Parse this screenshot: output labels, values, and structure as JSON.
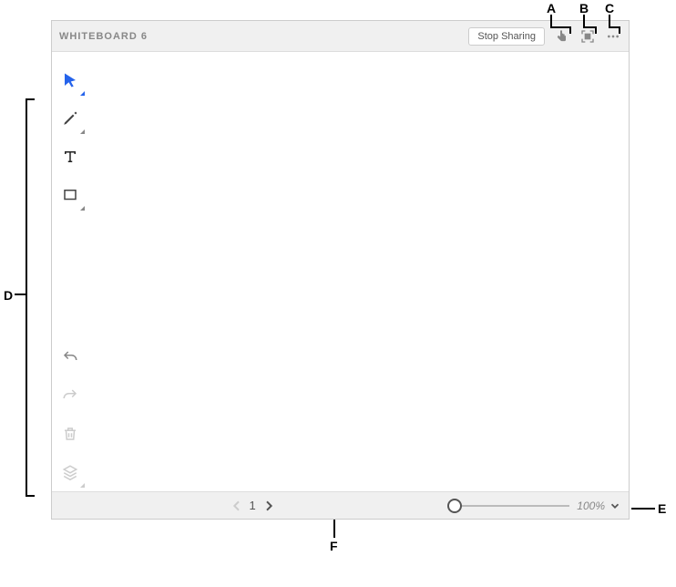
{
  "header": {
    "title": "WHITEBOARD 6",
    "stop_sharing_label": "Stop Sharing"
  },
  "footer": {
    "page_number": "1",
    "zoom_label": "100%"
  },
  "callouts": {
    "A": "A",
    "B": "B",
    "C": "C",
    "D": "D",
    "E": "E",
    "F": "F"
  }
}
